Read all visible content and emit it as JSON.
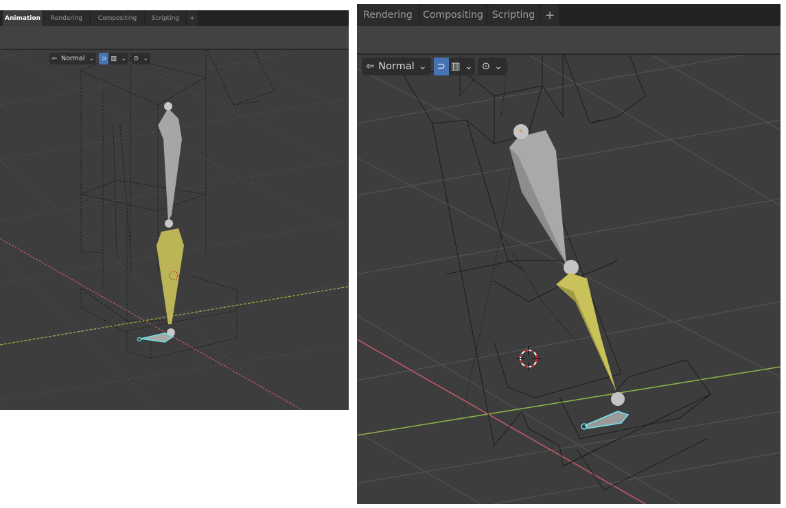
{
  "left_view": {
    "tabs": [
      {
        "label": "Animation",
        "active": true
      },
      {
        "label": "Rendering",
        "active": false
      },
      {
        "label": "Compositing",
        "active": false
      },
      {
        "label": "Scripting",
        "active": false
      }
    ],
    "add_tab_label": "+",
    "toolbar": {
      "orientation_icon": "transform-orientation-icon",
      "orientation_label": "Normal",
      "snap_icon": "snap-magnet-icon",
      "snap_active": true,
      "snap_target_icon": "snap-target-icon",
      "proportional_icon": "proportional-editing-icon"
    }
  },
  "right_view": {
    "tabs": [
      {
        "label": "Rendering",
        "active": false
      },
      {
        "label": "Compositing",
        "active": false
      },
      {
        "label": "Scripting",
        "active": false
      }
    ],
    "add_tab_label": "+",
    "toolbar": {
      "orientation_icon": "transform-orientation-icon",
      "orientation_label": "Normal",
      "snap_icon": "snap-magnet-icon",
      "snap_active": true,
      "snap_target_icon": "snap-target-icon",
      "proportional_icon": "proportional-editing-icon"
    }
  },
  "colors": {
    "viewport_bg": "#3d3d3d",
    "grid_line": "#4f4f4f",
    "x_axis": "#c2586a",
    "y_axis": "#8cb14a",
    "bone_upper": "#a8a8a8",
    "bone_lower": "#c9c25a",
    "bone_selected_outline": "#6fe3e8",
    "snap_active": "#4772b3",
    "cursor_red": "#d02020"
  }
}
